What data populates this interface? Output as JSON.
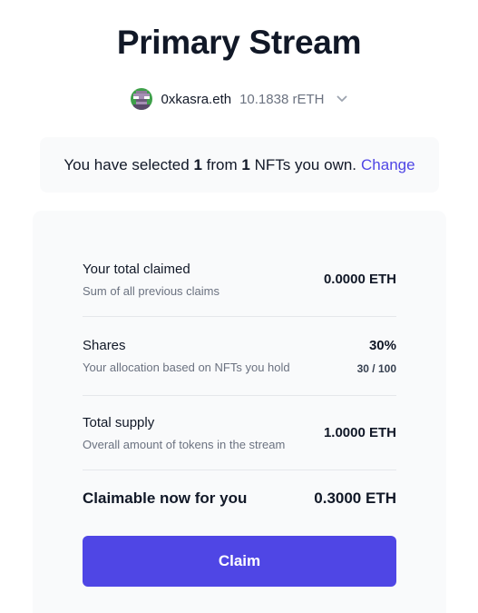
{
  "page": {
    "title": "Primary Stream"
  },
  "account": {
    "name": "0xkasra.eth",
    "balance": "10.1838 rETH",
    "avatar_icon": "pixel-avatar-icon",
    "dropdown_icon": "chevron-down-icon"
  },
  "notice": {
    "prefix": "You have selected",
    "selected_count": "1",
    "middle": "from",
    "owned_count": "1",
    "suffix": "NFTs you own.",
    "change_label": "Change"
  },
  "stats": {
    "claimed": {
      "label": "Your total claimed",
      "sublabel": "Sum of all previous claims",
      "value": "0.0000 ETH"
    },
    "shares": {
      "label": "Shares",
      "sublabel": "Your allocation based on NFTs you hold",
      "value": "30%",
      "detail": "30 / 100"
    },
    "supply": {
      "label": "Total supply",
      "sublabel": "Overall amount of tokens in the stream",
      "value": "1.0000 ETH"
    }
  },
  "claimable": {
    "label": "Claimable now for you",
    "value": "0.3000 ETH"
  },
  "claim_button": {
    "label": "Claim"
  },
  "colors": {
    "accent": "#4f46e5",
    "card_bg": "#f9fafb",
    "text": "#111827",
    "muted": "#6b7280"
  }
}
